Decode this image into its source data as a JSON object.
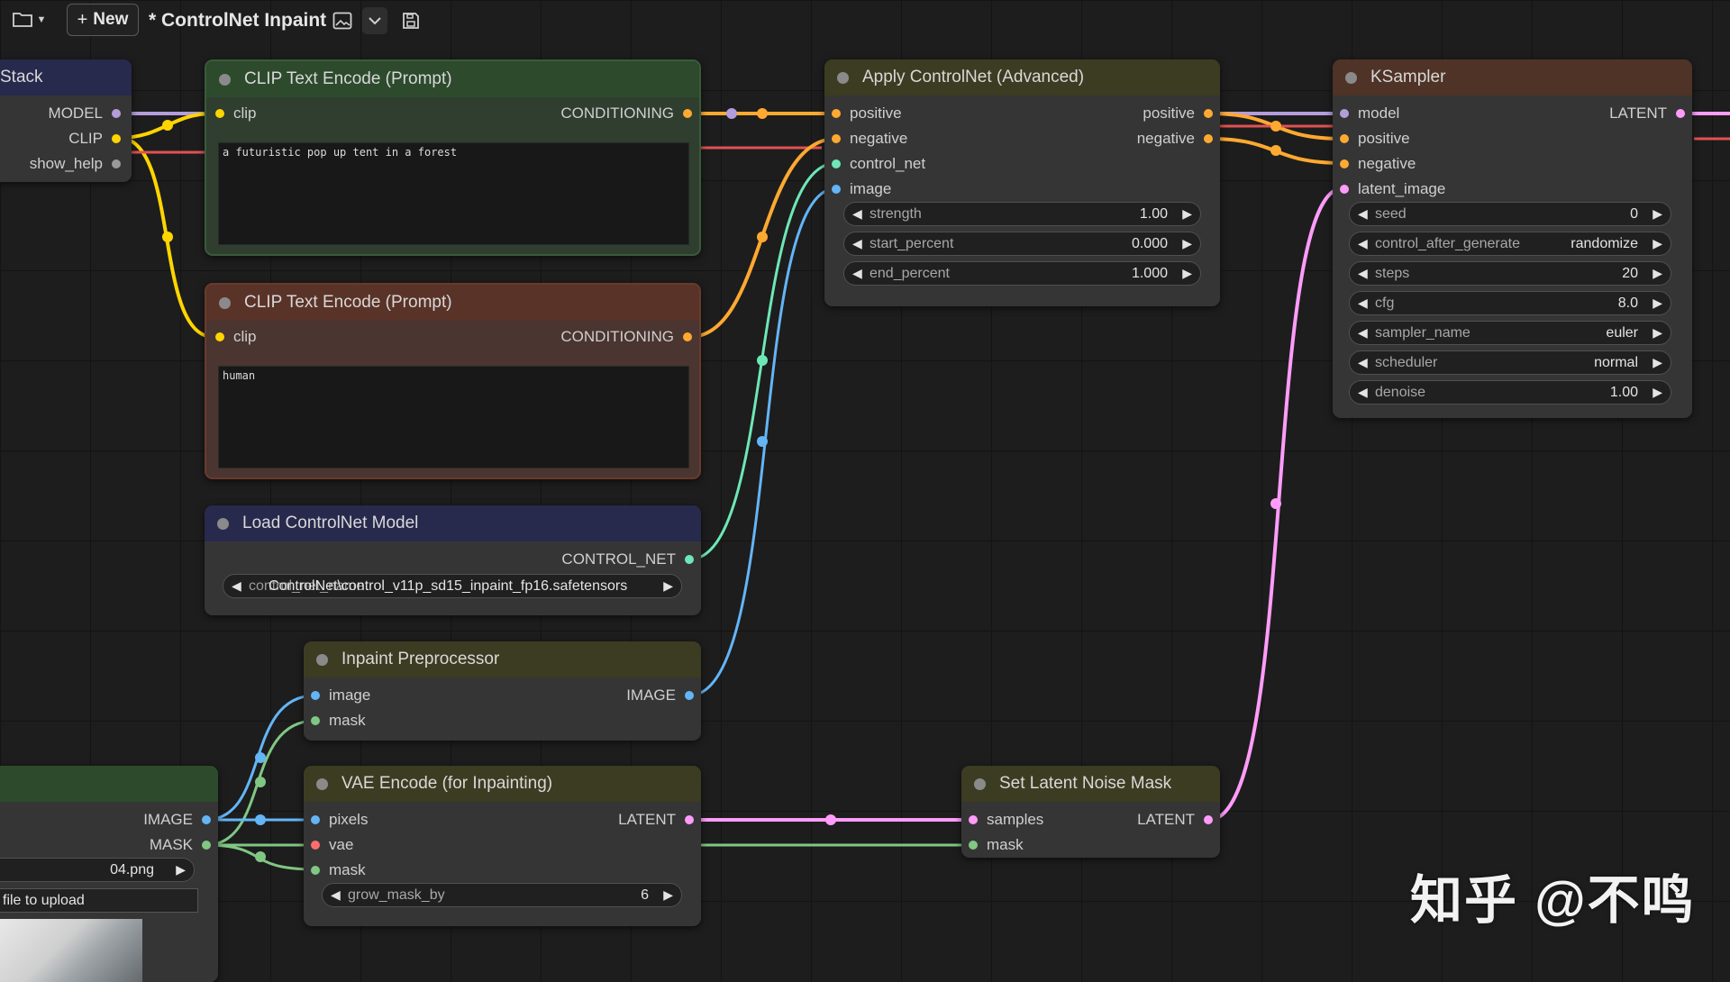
{
  "topbar": {
    "new_label": "New",
    "workflow_title": "* ControlNet Inpaint"
  },
  "nodes": {
    "lora_stack": {
      "title": "Stack",
      "outputs": [
        "MODEL",
        "CLIP",
        "show_help"
      ]
    },
    "clip_pos": {
      "title": "CLIP Text Encode (Prompt)",
      "input": "clip",
      "output": "CONDITIONING",
      "text": "a futuristic pop up tent in a forest"
    },
    "clip_neg": {
      "title": "CLIP Text Encode (Prompt)",
      "input": "clip",
      "output": "CONDITIONING",
      "text": "human"
    },
    "load_cn": {
      "title": "Load ControlNet Model",
      "output": "CONTROL_NET",
      "widget_value": "ControlNet\\control_v11p_sd15_inpaint_fp16.safetensors",
      "widget_name_ghost": "control_net_name"
    },
    "inpaint_pre": {
      "title": "Inpaint Preprocessor",
      "inputs": [
        "image",
        "mask"
      ],
      "output": "IMAGE"
    },
    "vae_encode": {
      "title": "VAE Encode (for Inpainting)",
      "inputs": [
        "pixels",
        "vae",
        "mask"
      ],
      "output": "LATENT",
      "widget": {
        "name": "grow_mask_by",
        "value": "6"
      }
    },
    "load_image": {
      "outputs": [
        "IMAGE",
        "MASK"
      ],
      "filename": "04.png",
      "upload_label": "file to upload"
    },
    "apply_cn": {
      "title": "Apply ControlNet (Advanced)",
      "inputs": [
        "positive",
        "negative",
        "control_net",
        "image"
      ],
      "outputs": [
        "positive",
        "negative"
      ],
      "widgets": [
        {
          "name": "strength",
          "value": "1.00"
        },
        {
          "name": "start_percent",
          "value": "0.000"
        },
        {
          "name": "end_percent",
          "value": "1.000"
        }
      ]
    },
    "ksampler": {
      "title": "KSampler",
      "inputs": [
        "model",
        "positive",
        "negative",
        "latent_image"
      ],
      "output": "LATENT",
      "widgets": [
        {
          "name": "seed",
          "value": "0"
        },
        {
          "name": "control_after_generate",
          "value": "randomize"
        },
        {
          "name": "steps",
          "value": "20"
        },
        {
          "name": "cfg",
          "value": "8.0"
        },
        {
          "name": "sampler_name",
          "value": "euler"
        },
        {
          "name": "scheduler",
          "value": "normal"
        },
        {
          "name": "denoise",
          "value": "1.00"
        }
      ]
    },
    "latent_mask": {
      "title": "Set Latent Noise Mask",
      "inputs": [
        "samples",
        "mask"
      ],
      "output": "LATENT"
    }
  },
  "colors": {
    "clip": "#ffd500",
    "conditioning": "#ffa931",
    "model": "#b39ddb",
    "latent": "#ff9cf9",
    "image": "#64b5f6",
    "mask": "#81c784",
    "control_net": "#6ee7b7",
    "vae": "#ff6e6e",
    "wire_red": "#e05252",
    "title_green": "#2d4a2d",
    "title_brown": "#5a3328",
    "title_navy": "#27294d",
    "title_olive": "#3c3c22",
    "title_rust": "#4f3326"
  },
  "watermark": "知乎 @不鸣"
}
